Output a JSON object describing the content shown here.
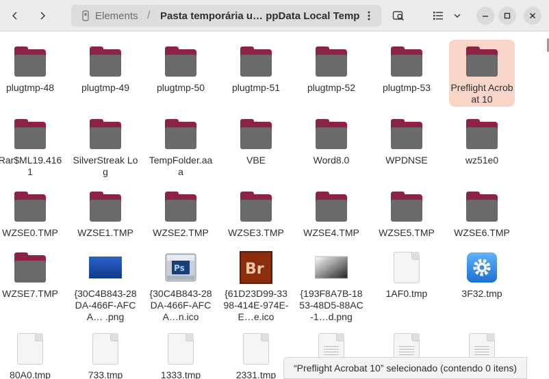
{
  "header": {
    "back_icon": "chevron-left-icon",
    "forward_icon": "chevron-right-icon",
    "path": {
      "location_icon": "usb-drive-icon",
      "root": "Elements",
      "separator": "/",
      "current": "Pasta temporária u… ppData Local Temp",
      "menu_icon": "vertical-dots-icon"
    },
    "search_icon": "image-search-icon",
    "view_icon": "list-view-icon",
    "view_options_icon": "chevron-down-icon",
    "window": {
      "minimize_icon": "minimize-icon",
      "maximize_icon": "maximize-icon",
      "close_icon": "close-icon"
    }
  },
  "items": [
    {
      "label": "plugtmp-48",
      "type": "folder"
    },
    {
      "label": "plugtmp-49",
      "type": "folder"
    },
    {
      "label": "plugtmp-50",
      "type": "folder"
    },
    {
      "label": "plugtmp-51",
      "type": "folder"
    },
    {
      "label": "plugtmp-52",
      "type": "folder"
    },
    {
      "label": "plugtmp-53",
      "type": "folder"
    },
    {
      "label": "Preflight Acrobat 10",
      "type": "folder",
      "selected": true
    },
    {
      "label": "Rar$ML19.4161",
      "type": "folder"
    },
    {
      "label": "SilverStreak Log",
      "type": "folder"
    },
    {
      "label": "TempFolder.aaa",
      "type": "folder"
    },
    {
      "label": "VBE",
      "type": "folder"
    },
    {
      "label": "Word8.0",
      "type": "folder"
    },
    {
      "label": "WPDNSE",
      "type": "folder"
    },
    {
      "label": "wz51e0",
      "type": "folder"
    },
    {
      "label": "WZSE0.TMP",
      "type": "folder"
    },
    {
      "label": "WZSE1.TMP",
      "type": "folder"
    },
    {
      "label": "WZSE2.TMP",
      "type": "folder"
    },
    {
      "label": "WZSE3.TMP",
      "type": "folder"
    },
    {
      "label": "WZSE4.TMP",
      "type": "folder"
    },
    {
      "label": "WZSE5.TMP",
      "type": "folder"
    },
    {
      "label": "WZSE6.TMP",
      "type": "folder"
    },
    {
      "label": "WZSE7.TMP",
      "type": "folder"
    },
    {
      "label": "{30C4B843-28DA-466F-AFCA… .png",
      "type": "blue-image"
    },
    {
      "label": "{30C4B843-28DA-466F-AFCA…n.ico",
      "type": "ps-image"
    },
    {
      "label": "{61D23D99-3398-414E-974E-E…e.ico",
      "type": "br-image"
    },
    {
      "label": "{193F8A7B-1853-48D5-88AC-1…d.png",
      "type": "gradient-image"
    },
    {
      "label": "1AF0.tmp",
      "type": "doc"
    },
    {
      "label": "3F32.tmp",
      "type": "gear-image"
    },
    {
      "label": "80A0.tmp",
      "type": "doc"
    },
    {
      "label": "733.tmp",
      "type": "doc"
    },
    {
      "label": "1333.tmp",
      "type": "doc"
    },
    {
      "label": "2331.tmp",
      "type": "doc"
    },
    {
      "label": "",
      "type": "doc-lines"
    },
    {
      "label": "",
      "type": "doc-lines"
    },
    {
      "label": "",
      "type": "doc-lines"
    }
  ],
  "status": "“Preflight Acrobat 10” selecionado  (contendo 0 itens)",
  "colors": {
    "folder_back": "#8c2346",
    "folder_front": "#6a6a6a",
    "selection": "#f9d4c9",
    "header_bg": "#ebebeb"
  }
}
